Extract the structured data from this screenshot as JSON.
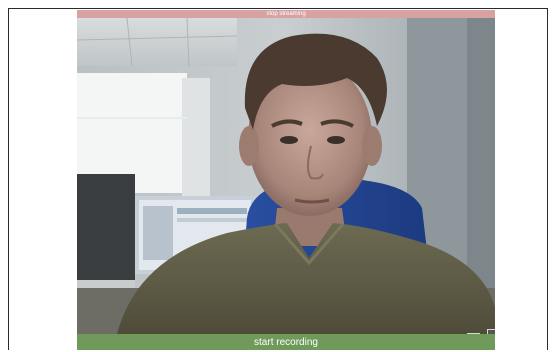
{
  "controls": {
    "stop_streaming_label": "stop streaming",
    "start_recording_label": "start recording"
  },
  "video": {
    "size_options": [
      {
        "name": "size-small"
      },
      {
        "name": "size-medium"
      },
      {
        "name": "size-large",
        "selected": true
      },
      {
        "name": "size-xlarge"
      }
    ]
  },
  "colors": {
    "stop_bar": "#d9a2a2",
    "record_bar": "#6f9a5a"
  }
}
